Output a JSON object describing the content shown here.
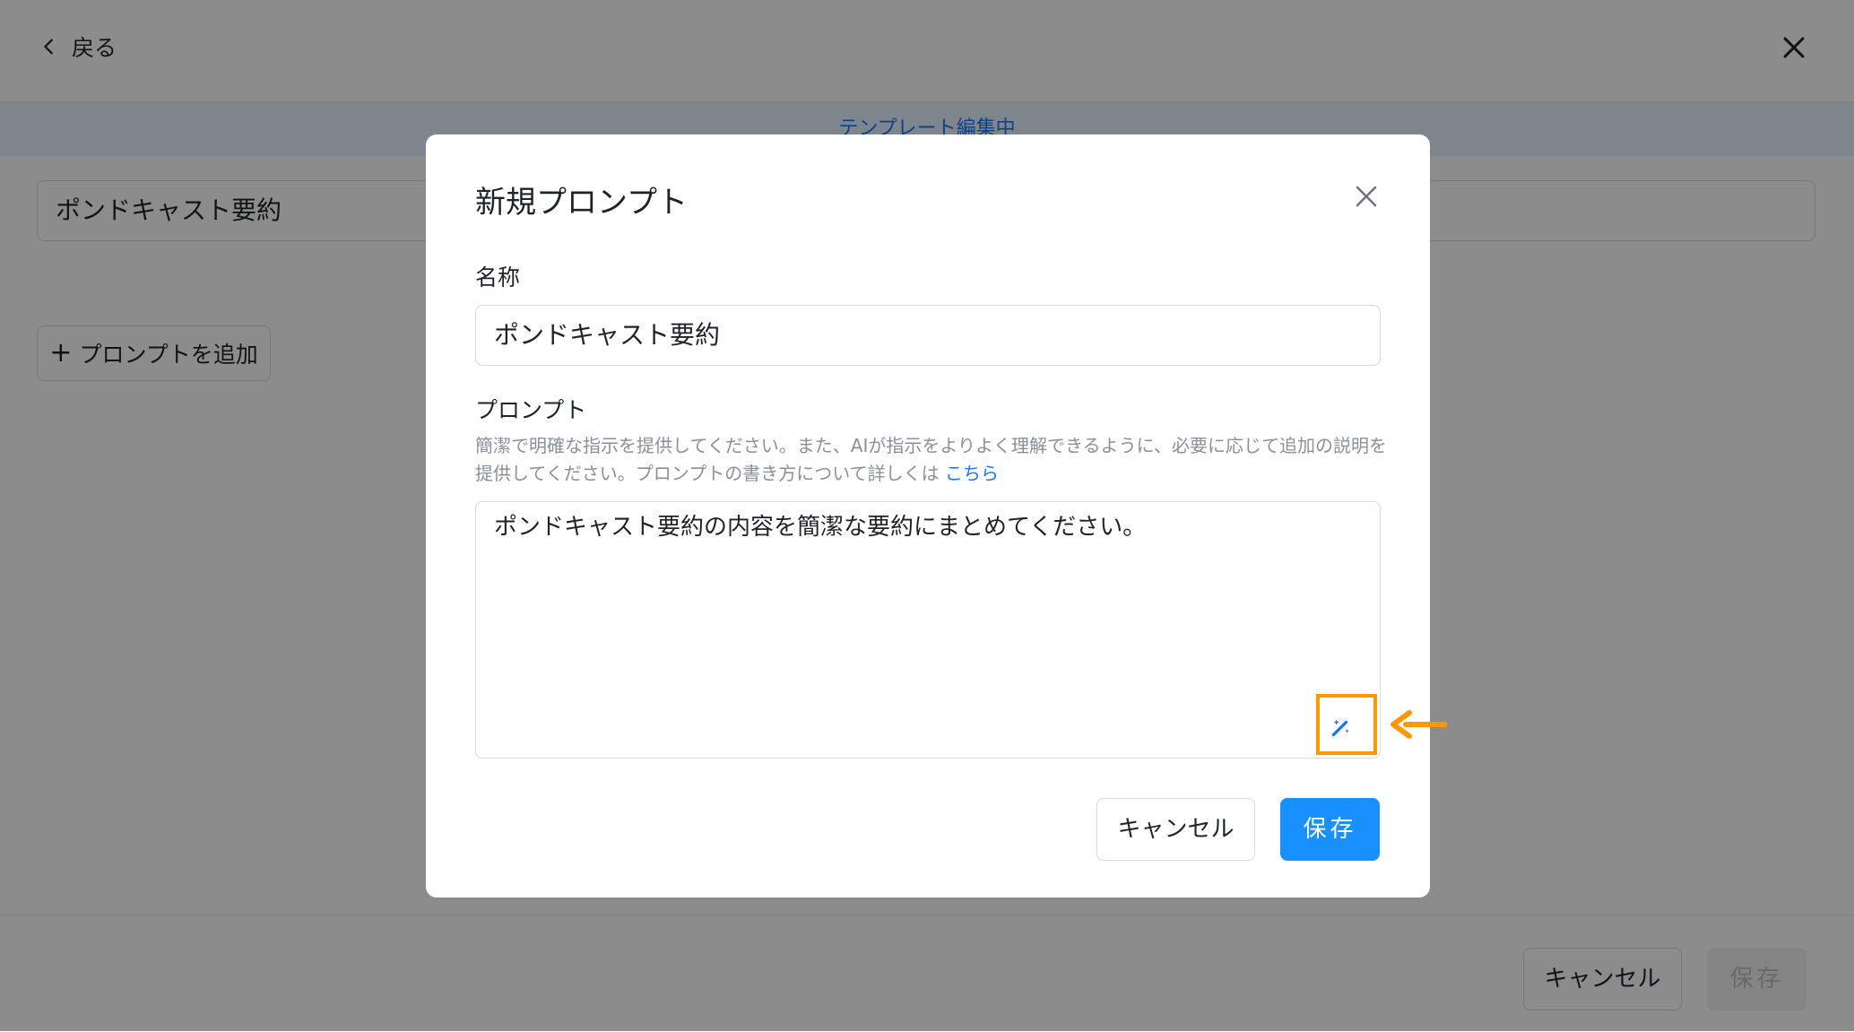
{
  "page": {
    "back_label": "戻る",
    "banner_text": "テンプレート編集中",
    "template_name": "ポンドキャスト要約",
    "add_prompt_label": "プロンプトを追加",
    "footer_cancel_label": "キャンセル",
    "footer_save_label": "保存"
  },
  "modal": {
    "title": "新規プロンプト",
    "name_label": "名称",
    "name_value": "ポンドキャスト要約",
    "prompt_label": "プロンプト",
    "help_text": "簡潔で明確な指示を提供してください。また、AIが指示をよりよく理解できるように、必要に応じて追加の説明を提供してください。プロンプトの書き方について詳しくは ",
    "help_link": "こちら",
    "prompt_value": "ポンドキャスト要約の内容を簡潔な要約にまとめてください。",
    "cancel_label": "キャンセル",
    "save_label": "保存"
  },
  "colors": {
    "primary": "#1890ff",
    "highlight": "#ff9800",
    "overlay": "rgba(0,0,0,0.45)"
  },
  "icons": [
    "chevron-left-icon",
    "close-icon",
    "plus-icon",
    "magic-wand-icon",
    "arrow-left-icon"
  ]
}
